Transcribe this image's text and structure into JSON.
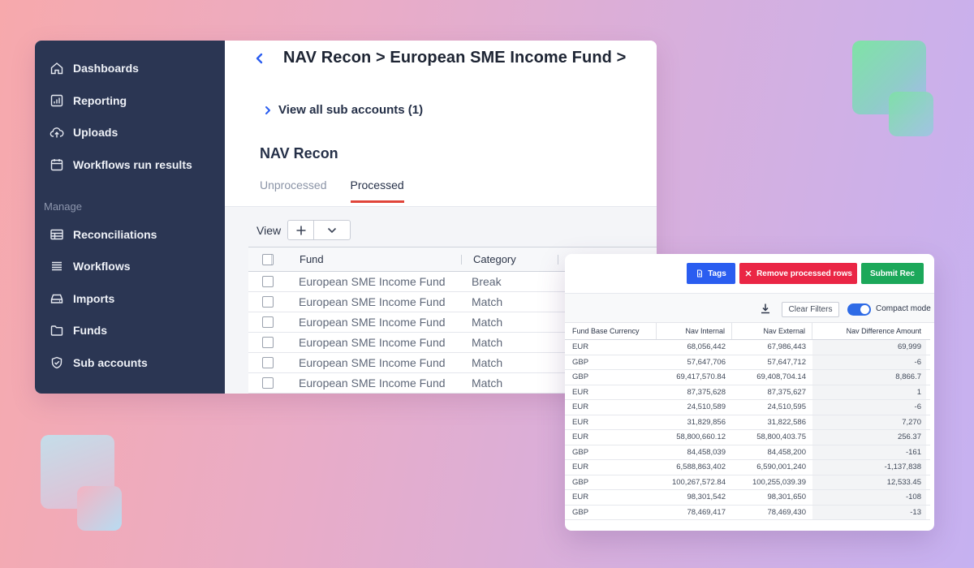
{
  "sidebar": {
    "items": [
      {
        "label": "Dashboards",
        "icon": "home-icon"
      },
      {
        "label": "Reporting",
        "icon": "report-chart-icon"
      },
      {
        "label": "Uploads",
        "icon": "cloud-upload-icon"
      },
      {
        "label": "Workflows run results",
        "icon": "calendar-icon"
      }
    ],
    "manage_label": "Manage",
    "manage_items": [
      {
        "label": "Reconciliations",
        "icon": "table-icon"
      },
      {
        "label": "Workflows",
        "icon": "stack-icon"
      },
      {
        "label": "Imports",
        "icon": "drive-icon"
      },
      {
        "label": "Funds",
        "icon": "folder-icon"
      },
      {
        "label": "Sub accounts",
        "icon": "shield-check-icon"
      }
    ]
  },
  "header": {
    "breadcrumb": "NAV Recon > European SME Income Fund >",
    "sub_accounts_link": "View all sub accounts (1)",
    "section_title": "NAV Recon",
    "tabs": [
      "Unprocessed",
      "Processed"
    ],
    "active_tab": "Processed",
    "view_label": "View"
  },
  "fund_table": {
    "columns": [
      "Fund",
      "Category"
    ],
    "rows": [
      {
        "fund": "European SME Income Fund",
        "category": "Break"
      },
      {
        "fund": "European SME Income Fund",
        "category": "Match"
      },
      {
        "fund": "European SME Income Fund",
        "category": "Match"
      },
      {
        "fund": "European SME Income Fund",
        "category": "Match"
      },
      {
        "fund": "European SME Income Fund",
        "category": "Match"
      },
      {
        "fund": "European SME Income Fund",
        "category": "Match"
      }
    ]
  },
  "grid_panel": {
    "buttons": {
      "tags": "Tags",
      "remove": "Remove processed rows",
      "submit": "Submit Rec"
    },
    "clear_filters": "Clear Filters",
    "compact_mode": "Compact mode",
    "compact_mode_on": true,
    "columns": [
      "Fund Base Currency",
      "Nav Internal",
      "Nav External",
      "Nav Difference Amount"
    ],
    "rows": [
      [
        "EUR",
        "68,056,442",
        "67,986,443",
        "69,999"
      ],
      [
        "GBP",
        "57,647,706",
        "57,647,712",
        "-6"
      ],
      [
        "GBP",
        "69,417,570.84",
        "69,408,704.14",
        "8,866.7"
      ],
      [
        "EUR",
        "87,375,628",
        "87,375,627",
        "1"
      ],
      [
        "EUR",
        "24,510,589",
        "24,510,595",
        "-6"
      ],
      [
        "EUR",
        "31,829,856",
        "31,822,586",
        "7,270"
      ],
      [
        "EUR",
        "58,800,660.12",
        "58,800,403.75",
        "256.37"
      ],
      [
        "GBP",
        "84,458,039",
        "84,458,200",
        "-161"
      ],
      [
        "EUR",
        "6,588,863,402",
        "6,590,001,240",
        "-1,137,838"
      ],
      [
        "GBP",
        "100,267,572.84",
        "100,255,039.39",
        "12,533.45"
      ],
      [
        "EUR",
        "98,301,542",
        "98,301,650",
        "-108"
      ],
      [
        "GBP",
        "78,469,417",
        "78,469,430",
        "-13"
      ]
    ]
  },
  "colors": {
    "sidebar_bg": "#2b3653",
    "tab_accent": "#e0453a",
    "tags_button": "#2a5df0",
    "remove_button": "#ea2645",
    "submit_button": "#1ca85a",
    "toggle_on": "#2e6be6"
  }
}
